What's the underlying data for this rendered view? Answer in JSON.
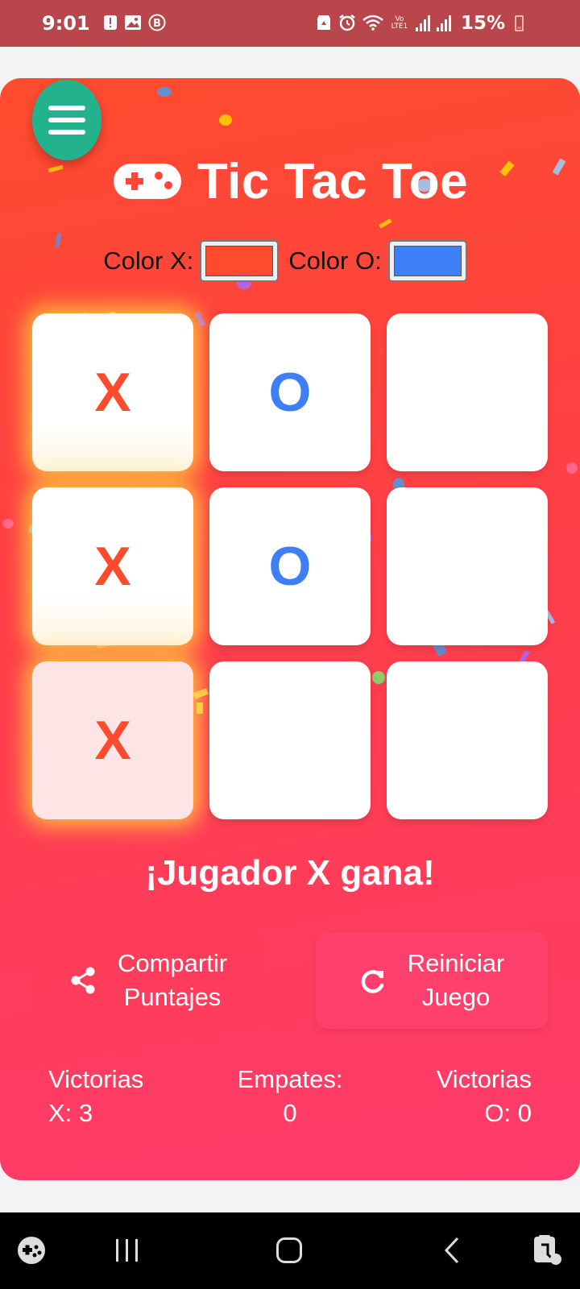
{
  "status_bar": {
    "time": "9:01",
    "battery": "15%",
    "left_icons": [
      "alert-icon",
      "gallery-icon",
      "b-icon"
    ],
    "right_icons": [
      "recycle-icon",
      "alarm-icon",
      "wifi-icon",
      "volte-icon",
      "signal-icon",
      "signal-icon-2"
    ],
    "volte_text": "Vo LTE1"
  },
  "header": {
    "title": "Tic Tac Toe",
    "menu_icon": "hamburger-menu-icon",
    "title_icon": "gamepad-icon"
  },
  "colors": {
    "x_label": "Color X:",
    "o_label": "Color O:",
    "x_color": "#ff4a2e",
    "o_color": "#3e7ff5"
  },
  "board": {
    "cells": [
      "X",
      "O",
      "",
      "X",
      "O",
      "",
      "X",
      "",
      ""
    ],
    "winning_cells": [
      0,
      3,
      6
    ]
  },
  "result_text": "¡Jugador X gana!",
  "buttons": {
    "share_label_line1": "Compartir",
    "share_label_line2": "Puntajes",
    "reset_label_line1": "Reiniciar",
    "reset_label_line2": "Juego"
  },
  "stats": {
    "x_wins_line1": "Victorias",
    "x_wins_line2": "X: 3",
    "draws_line1": "Empates:",
    "draws_line2": "0",
    "o_wins_line1": "Victorias",
    "o_wins_line2": "O: 0"
  },
  "nav_bar": {
    "icons": [
      "game-launcher-icon",
      "recent-apps-icon",
      "home-icon",
      "back-icon",
      "accessibility-icon"
    ]
  },
  "accent_colors": {
    "menu_button": "#22b38e",
    "card_top": "#ff4b2e",
    "card_bottom": "#ff3b6c",
    "win_glow": "#ffd73c"
  }
}
